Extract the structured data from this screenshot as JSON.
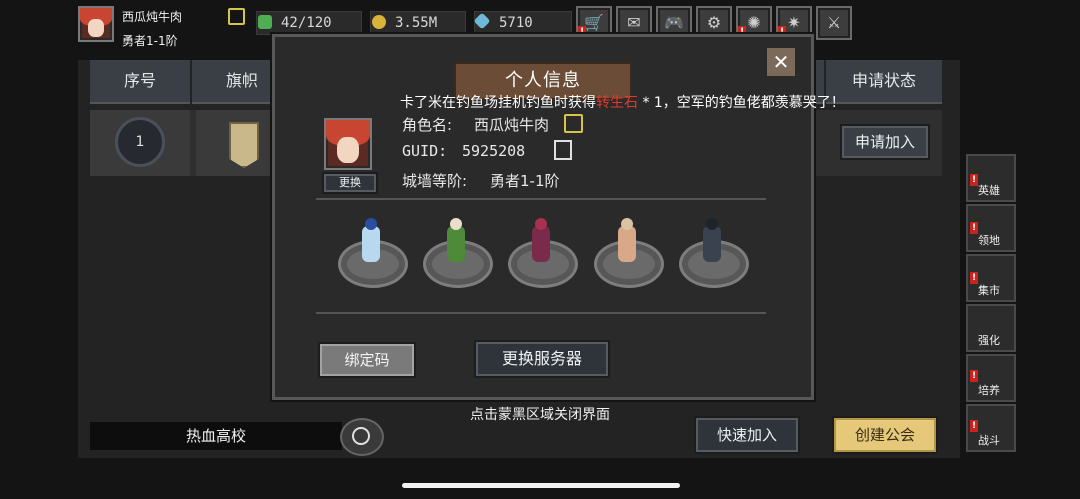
{
  "player": {
    "name": "西瓜炖牛肉",
    "rank": "勇者1-1阶"
  },
  "resources": {
    "energy": "42/120",
    "gold": "3.55M",
    "gems": "5710"
  },
  "top_buttons": [
    "shop-cart-icon",
    "mail-icon",
    "gamepad-icon",
    "gear-icon",
    "pinwheel-icon",
    "firework-icon",
    "crossed-swords-icon"
  ],
  "table": {
    "headers": {
      "index": "序号",
      "flag": "旗帜",
      "status": "申请状态"
    },
    "rows": [
      {
        "index": "1",
        "action": "申请加入"
      }
    ]
  },
  "sidebar": [
    {
      "label": "英雄",
      "icon": "helmet-icon"
    },
    {
      "label": "领地",
      "icon": "castle-icon"
    },
    {
      "label": "集市",
      "icon": "market-icon"
    },
    {
      "label": "强化",
      "icon": "enhance-icon"
    },
    {
      "label": "培养",
      "icon": "potion-icon"
    },
    {
      "label": "战斗",
      "icon": "portal-icon"
    }
  ],
  "bottom": {
    "search_value": "热血高校",
    "hint": "点击蒙黑区域关闭界面",
    "quick_join": "快速加入",
    "create_guild": "创建公会"
  },
  "modal": {
    "title": "个人信息",
    "marquee_pre": "卡了米在钓鱼场挂机钓鱼时获得",
    "marquee_item": "转生石",
    "marquee_post": " * 1，空军的钓鱼佬都羡慕哭了！",
    "change_avatar": "更换",
    "role_label": "角色名:",
    "role_name": "西瓜炖牛肉",
    "guid_label": "GUID:",
    "guid_value": "5925208",
    "wall_label": "城墙等阶:",
    "wall_value": "勇者1-1阶",
    "bind_code": "绑定码",
    "change_server": "更换服务器"
  },
  "colors": {
    "accent_gold": "#e5c87a",
    "alert_red": "#c8231c",
    "marquee_red": "#e13a2c"
  }
}
